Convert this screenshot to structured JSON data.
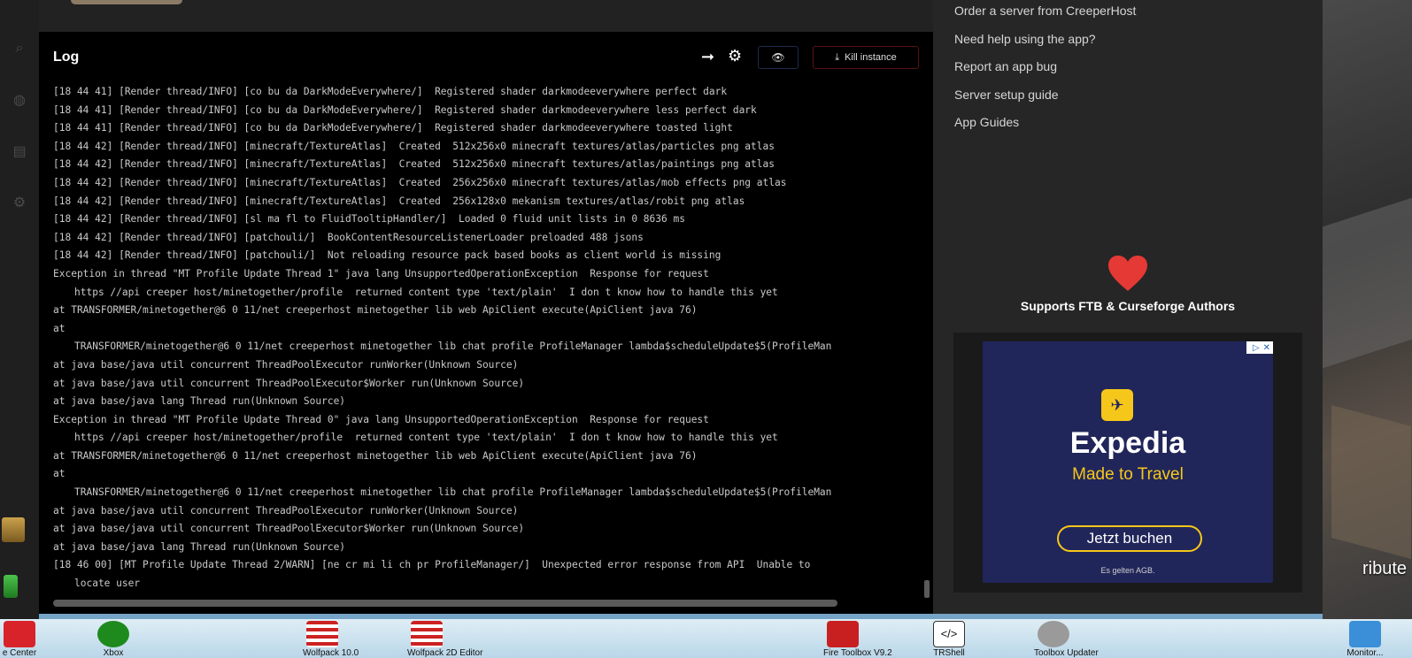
{
  "log": {
    "title": "Log",
    "eye_label": "👁",
    "kill_label": "Kill instance",
    "lines": [
      "[18 44 41] [Render thread/INFO] [co bu da DarkModeEverywhere/]  Registered shader darkmodeeverywhere perfect dark",
      "[18 44 41] [Render thread/INFO] [co bu da DarkModeEverywhere/]  Registered shader darkmodeeverywhere less perfect dark",
      "[18 44 41] [Render thread/INFO] [co bu da DarkModeEverywhere/]  Registered shader darkmodeeverywhere toasted light",
      "[18 44 42] [Render thread/INFO] [minecraft/TextureAtlas]  Created  512x256x0 minecraft textures/atlas/particles png atlas",
      "[18 44 42] [Render thread/INFO] [minecraft/TextureAtlas]  Created  512x256x0 minecraft textures/atlas/paintings png atlas",
      "[18 44 42] [Render thread/INFO] [minecraft/TextureAtlas]  Created  256x256x0 minecraft textures/atlas/mob effects png atlas",
      "[18 44 42] [Render thread/INFO] [minecraft/TextureAtlas]  Created  256x128x0 mekanism textures/atlas/robit png atlas",
      "[18 44 42] [Render thread/INFO] [sl ma fl to FluidTooltipHandler/]  Loaded 0 fluid unit lists in 0 8636 ms",
      "[18 44 42] [Render thread/INFO] [patchouli/]  BookContentResourceListenerLoader preloaded 488 jsons",
      "[18 44 42] [Render thread/INFO] [patchouli/]  Not reloading resource pack based books as client world is missing",
      "Exception in thread \"MT Profile Update Thread 1\" java lang UnsupportedOperationException  Response for request",
      "    https //api creeper host/minetogether/profile  returned content type 'text/plain'  I don t know how to handle this yet",
      "at TRANSFORMER/minetogether@6 0 11/net creeperhost minetogether lib web ApiClient execute(ApiClient java 76)",
      "at",
      "   TRANSFORMER/minetogether@6 0 11/net creeperhost minetogether lib chat profile ProfileManager lambda$scheduleUpdate$5(ProfileMan",
      "at java base/java util concurrent ThreadPoolExecutor runWorker(Unknown Source)",
      "at java base/java util concurrent ThreadPoolExecutor$Worker run(Unknown Source)",
      "at java base/java lang Thread run(Unknown Source)",
      "Exception in thread \"MT Profile Update Thread 0\" java lang UnsupportedOperationException  Response for request",
      "    https //api creeper host/minetogether/profile  returned content type 'text/plain'  I don t know how to handle this yet",
      "at TRANSFORMER/minetogether@6 0 11/net creeperhost minetogether lib web ApiClient execute(ApiClient java 76)",
      "at",
      "   TRANSFORMER/minetogether@6 0 11/net creeperhost minetogether lib chat profile ProfileManager lambda$scheduleUpdate$5(ProfileMan",
      "at java base/java util concurrent ThreadPoolExecutor runWorker(Unknown Source)",
      "at java base/java util concurrent ThreadPoolExecutor$Worker run(Unknown Source)",
      "at java base/java lang Thread run(Unknown Source)",
      "[18 46 00] [MT Profile Update Thread 2/WARN] [ne cr mi li ch pr ProfileManager/]  Unexpected error response from API  Unable to",
      "    locate user"
    ]
  },
  "help": {
    "links": [
      "Order a server from CreeperHost",
      "Need help using the app?",
      "Report an app bug",
      "Server setup guide",
      "App Guides"
    ],
    "support_text": "Supports FTB & Curseforge Authors"
  },
  "ad": {
    "brand": "Expedia",
    "tagline": "Made to Travel",
    "cta": "Jetzt buchen",
    "fine_print": "Es gelten AGB.",
    "close_label": "✕",
    "info_label": "▷"
  },
  "desktop": {
    "right_label": "ribute",
    "icons": [
      {
        "caption": "e Center"
      },
      {
        "caption": "Xbox"
      },
      {
        "caption": "Wolfpack 10.0"
      },
      {
        "caption": "Wolfpack 2D Editor"
      },
      {
        "caption": "Fire Toolbox V9.2"
      },
      {
        "caption": "TRShell"
      },
      {
        "caption": "Toolbox Updater"
      },
      {
        "caption": "Monitor..."
      }
    ]
  },
  "colors": {
    "accent_heart": "#e53935",
    "expedia_yellow": "#f6c71b",
    "expedia_navy": "#21265a"
  }
}
